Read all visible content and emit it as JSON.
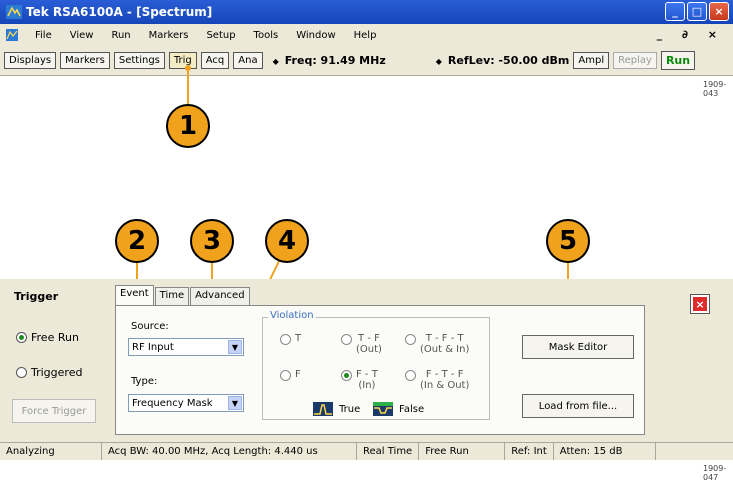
{
  "window": {
    "title": "Tek RSA6100A - [Spectrum]",
    "min": "_",
    "max": "□",
    "close": "×"
  },
  "menu": {
    "items": [
      "File",
      "View",
      "Run",
      "Markers",
      "Setup",
      "Tools",
      "Window",
      "Help"
    ],
    "doc_controls": "_ ∂ ×"
  },
  "toolbar": {
    "displays": "Displays",
    "markers": "Markers",
    "settings": "Settings",
    "trig": "Trig",
    "acq": "Acq",
    "ana": "Ana",
    "freq": "Freq: 91.49 MHz",
    "reflev": "RefLev: -50.00 dBm",
    "ampl": "Ampl",
    "replay": "Replay",
    "run": "Run"
  },
  "figure": {
    "id_top": "1909-043",
    "id_bottom": "1909-047"
  },
  "callouts": [
    "1",
    "2",
    "3",
    "4",
    "5"
  ],
  "trigger": {
    "title": "Trigger",
    "free_run": "Free Run",
    "triggered": "Triggered",
    "force": "Force Trigger",
    "mode": "free_run",
    "tabs": [
      "Event",
      "Time",
      "Advanced"
    ],
    "source_label": "Source:",
    "source_value": "RF Input",
    "type_label": "Type:",
    "type_value": "Frequency Mask",
    "violation": {
      "title": "Violation",
      "t": "T",
      "tf": "T - F",
      "tf_sub": "(Out)",
      "tft": "T - F - T",
      "tft_sub": "(Out & In)",
      "f": "F",
      "ft": "F - T",
      "ft_sub": "(In)",
      "ftf": "F - T - F",
      "ftf_sub": "(In & Out)",
      "selected": "ft",
      "true_label": "True",
      "false_label": "False"
    },
    "mask_editor": "Mask Editor",
    "load_file": "Load from file...",
    "close": "×"
  },
  "status": {
    "analyzing": "Analyzing",
    "acq": "Acq BW: 40.00 MHz, Acq Length: 4.440 us",
    "realtime": "Real Time",
    "freerun": "Free Run",
    "ref": "Ref: Int",
    "atten": "Atten: 15 dB"
  }
}
